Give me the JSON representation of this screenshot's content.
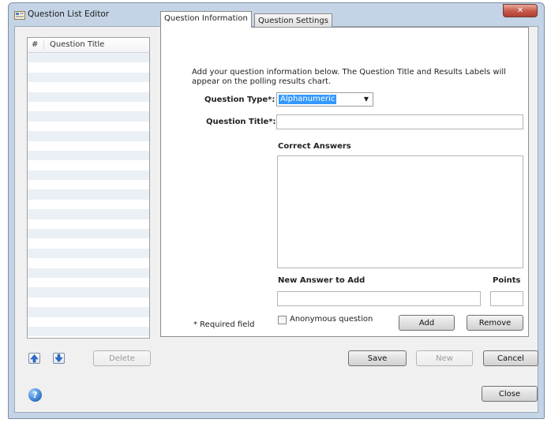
{
  "window": {
    "title": "Question List Editor",
    "close_label": "✕"
  },
  "question_list": {
    "columns": [
      "#",
      "Question Title"
    ],
    "row_count": 29,
    "delete_label": "Delete"
  },
  "tabs": [
    {
      "label": "Question Information",
      "active": true
    },
    {
      "label": "Question Settings",
      "active": false
    }
  ],
  "info": {
    "intro": "Add your question information below. The Question Title and Results Labels will appear on the polling results chart.",
    "question_type_label": "Question Type*:",
    "question_type_value": "Alphanumeric",
    "question_title_label": "Question Title*:",
    "question_title_value": "",
    "correct_answers_label": "Correct Answers",
    "new_answer_label": "New Answer to Add",
    "points_label": "Points",
    "anonymous_label": "Anonymous question",
    "required_note": "* Required field",
    "add_label": "Add",
    "remove_label": "Remove"
  },
  "footer": {
    "save_label": "Save",
    "new_label": "New",
    "cancel_label": "Cancel",
    "close_label": "Close",
    "help_glyph": "?"
  },
  "icons": {
    "app": "editor-app-icon",
    "move_up": "arrow-up-icon",
    "move_down": "arrow-down-icon",
    "help": "help-icon"
  },
  "colors": {
    "selection": "#3399ff",
    "window_frame": "#c4d4e6",
    "close_button": "#c6584a"
  }
}
